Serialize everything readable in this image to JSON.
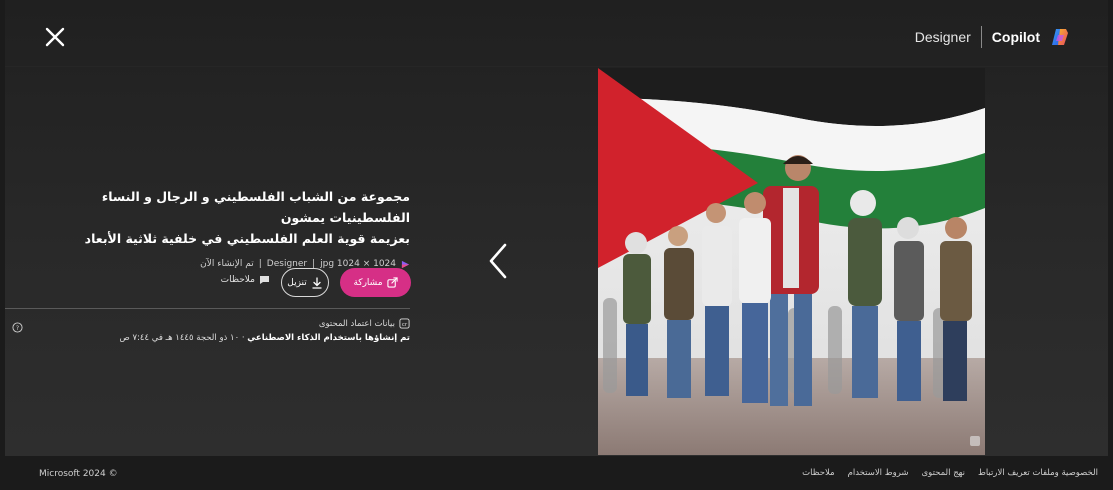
{
  "header": {
    "designer_label": "Designer",
    "copilot_label": "Copilot"
  },
  "info": {
    "title_line1": "مجموعة من الشباب الفلسطيني و الرجال و النساء الفلسطينيات يمشون",
    "title_line2": "بعزيمة قوية العلم الفلسطيني في خلفية ثلاثية الأبعاد",
    "meta_created": "تم الإنشاء الآن",
    "meta_source": "Designer",
    "meta_dims": "jpg 1024 × 1024"
  },
  "actions": {
    "share_label": "مشاركة",
    "download_label": "تنزيل",
    "feedback_label": "ملاحظات"
  },
  "credentials": {
    "title": "بيانات اعتماد المحتوى",
    "generated_prefix": "تم إنشاؤها باستخدام الذكاء الاصطناعي",
    "date": "١٠ ذو الحجة ١٤٤٥ هـ في ٧:٤٤ ص"
  },
  "footer": {
    "copyright": "Microsoft 2024 ©",
    "links": [
      "الخصوصية وملفات تعريف الارتباط",
      "نهج المحتوى",
      "شروط الاستخدام",
      "ملاحظات"
    ]
  },
  "colors": {
    "accent": "#d62f86",
    "background": "#1b1b1b"
  },
  "icons": [
    "close-icon",
    "chevron-left-icon",
    "share-icon",
    "download-icon",
    "feedback-icon",
    "credentials-icon",
    "help-icon",
    "copilot-logo-icon",
    "designer-logo-icon"
  ]
}
